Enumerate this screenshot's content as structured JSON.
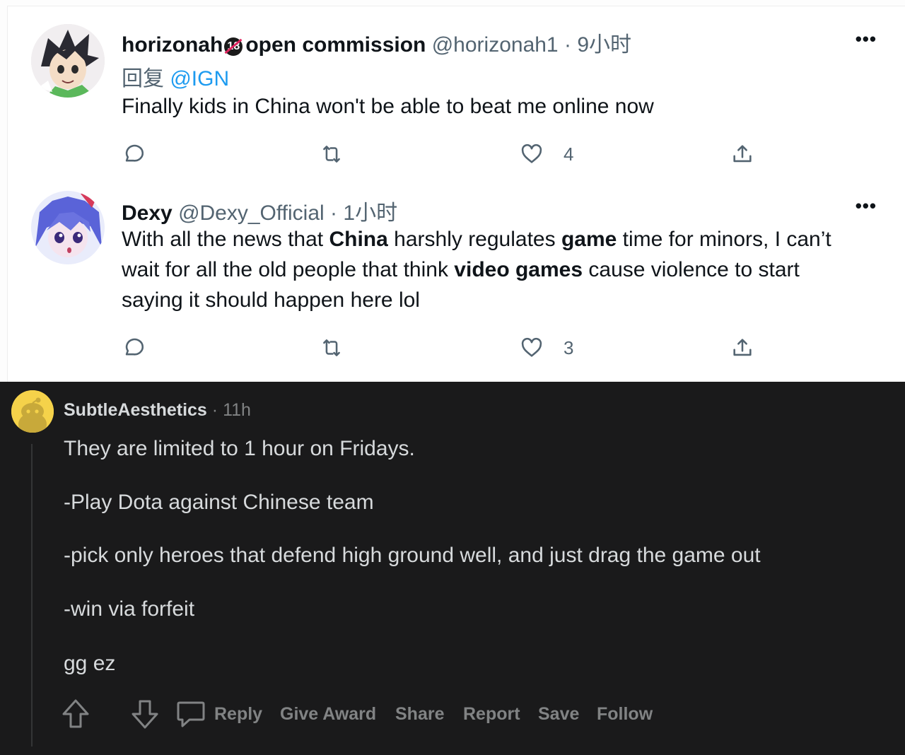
{
  "tweets": [
    {
      "display_name": "horizonah",
      "badge": "18",
      "name_suffix": "open commission",
      "handle": "@horizonah1",
      "separator": "·",
      "time": "9小时",
      "reply_prefix": "回复",
      "reply_mention": "@IGN",
      "text": "Finally kids in China won't be able to beat me online now",
      "more": "•••",
      "likes": "4"
    },
    {
      "display_name": "Dexy",
      "handle": "@Dexy_Official",
      "separator": "·",
      "time": "1小时",
      "more": "•••",
      "text_parts": [
        "With all the news that ",
        "China",
        " harshly regulates ",
        "game",
        " time for minors, I can’t",
        "wait for all the old people that think ",
        "video games",
        " cause violence to start",
        "saying it should happen here lol"
      ],
      "likes": "3"
    }
  ],
  "icons": {
    "reply": "reply-icon",
    "retweet": "retweet-icon",
    "like": "heart-icon",
    "share": "share-icon",
    "upvote": "upvote-icon",
    "downvote": "downvote-icon",
    "comment": "comment-icon"
  },
  "colors": {
    "twitter_link": "#1d9bf0",
    "reddit_bg": "#1a1a1b",
    "reddit_text": "#d7dadc",
    "reddit_muted": "#818384"
  },
  "reddit": {
    "username": "SubtleAesthetics",
    "separator": "·",
    "time": "11h",
    "lines": [
      "They are limited to 1 hour on Fridays.",
      "-Play Dota against Chinese team",
      "-pick only heroes that defend high ground well, and just drag the game out",
      "-win via forfeit",
      "gg ez"
    ],
    "actions": {
      "reply": "Reply",
      "give_award": "Give Award",
      "share": "Share",
      "report": "Report",
      "save": "Save",
      "follow": "Follow"
    }
  }
}
